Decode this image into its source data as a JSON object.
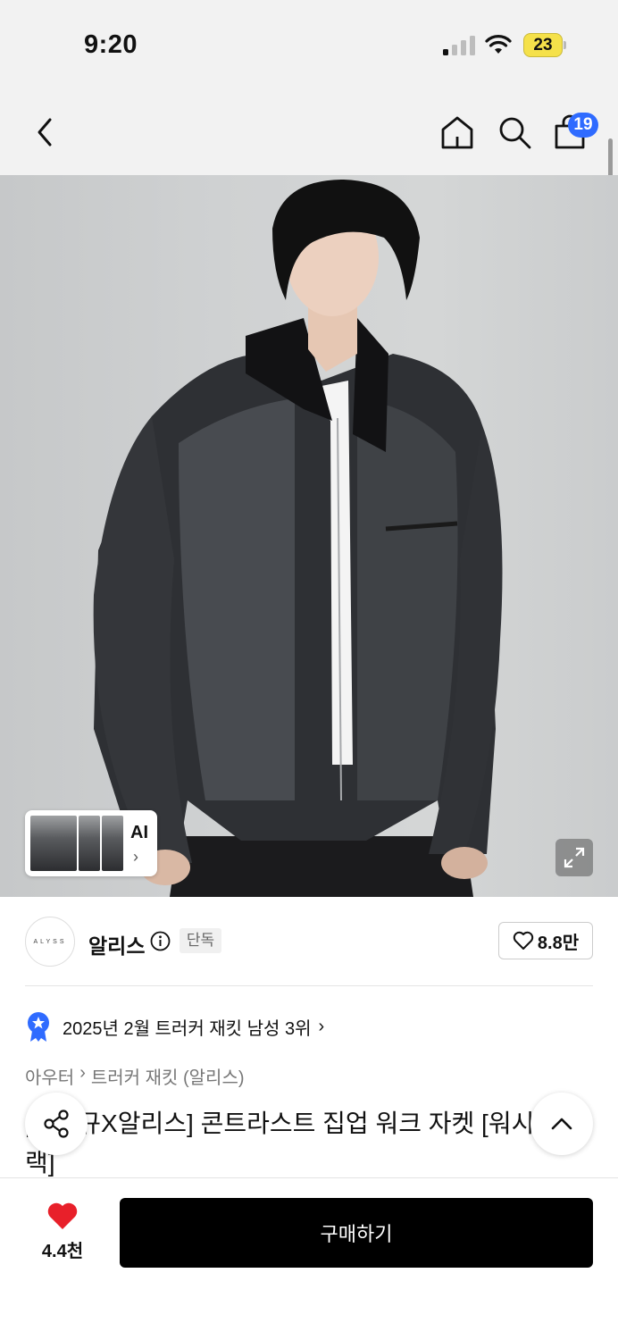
{
  "status_bar": {
    "time": "9:20",
    "battery": "23"
  },
  "nav": {
    "cart_count": "19"
  },
  "hero": {
    "ai_label": "AI"
  },
  "brand": {
    "logo_text": "ALYSS",
    "name": "알리스",
    "badge": "단독",
    "likes": "8.8만"
  },
  "ranking": {
    "text": "2025년 2월 트러커 재킷 남성 3위"
  },
  "breadcrumb": {
    "category": "아우터",
    "subcategory": "트러커 재킷 (알리스)"
  },
  "product": {
    "title": "[최진규X알리스] 콘트라스트 집업 워크 자켓 [워시드블랙]"
  },
  "bottom_bar": {
    "like_count": "4.4천",
    "buy_label": "구매하기"
  },
  "colors": {
    "accent_blue": "#2f6bff",
    "heart_red": "#e8202a",
    "battery_yellow": "#f5e14a"
  }
}
